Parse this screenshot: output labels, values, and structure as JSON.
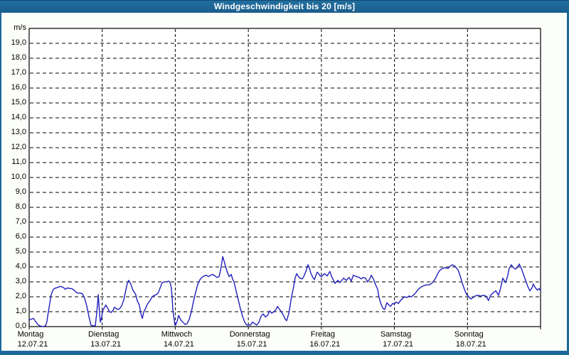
{
  "window": {
    "title": "Windgeschwindigkeit bis 20 [m/s]"
  },
  "colors": {
    "titlebar": "#1d689a",
    "frame": "#1d689a",
    "page_bg": "#fcfefa",
    "plot_bg": "#ffffff",
    "grid": "#000000",
    "text": "#000000",
    "line": "#2020bb"
  },
  "chart_data": {
    "type": "line",
    "title": "Windgeschwindigkeit bis 20 [m/s]",
    "ylabel": "m/s",
    "xlabel": "",
    "grid": true,
    "legend_position": "none",
    "y_axis": {
      "unit_label": "m/s",
      "min": 0,
      "max": 20,
      "tick_step": 1.0,
      "tick_labels": [
        "19,0",
        "18,0",
        "17,0",
        "16,0",
        "15,0",
        "14,0",
        "13,0",
        "12,0",
        "11,0",
        "10,0",
        "9,0",
        "8,0",
        "7,0",
        "6,0",
        "5,0",
        "4,0",
        "3,0",
        "2,0",
        "1,0",
        "0,0"
      ]
    },
    "x_axis": {
      "total_hours": 168,
      "days": [
        {
          "name": "Montag",
          "date": "12.07.21"
        },
        {
          "name": "Dienstag",
          "date": "13.07.21"
        },
        {
          "name": "Mittwoch",
          "date": "14.07.21"
        },
        {
          "name": "Donnerstag",
          "date": "15.07.21"
        },
        {
          "name": "Freitag",
          "date": "16.07.21"
        },
        {
          "name": "Samstag",
          "date": "17.07.21"
        },
        {
          "name": "Sonntag",
          "date": "18.07.21"
        }
      ]
    },
    "series": [
      {
        "name": "Windgeschwindigkeit",
        "unit": "m/s",
        "points": [
          [
            0,
            0.45
          ],
          [
            0.7,
            0.5
          ],
          [
            1.4,
            0.55
          ],
          [
            2.1,
            0.35
          ],
          [
            2.8,
            0.15
          ],
          [
            3.5,
            0.05
          ],
          [
            4.4,
            0
          ],
          [
            5.4,
            0.05
          ],
          [
            5.8,
            0.3
          ],
          [
            6.3,
            1.0
          ],
          [
            6.8,
            1.6
          ],
          [
            7.2,
            2.1
          ],
          [
            7.7,
            2.4
          ],
          [
            8.2,
            2.55
          ],
          [
            8.9,
            2.6
          ],
          [
            9.6,
            2.65
          ],
          [
            10.3,
            2.7
          ],
          [
            11,
            2.65
          ],
          [
            11.4,
            2.6
          ],
          [
            11.9,
            2.5
          ],
          [
            12.6,
            2.6
          ],
          [
            13.3,
            2.55
          ],
          [
            14,
            2.55
          ],
          [
            14.7,
            2.45
          ],
          [
            15.4,
            2.3
          ],
          [
            16.1,
            2.25
          ],
          [
            16.8,
            2.25
          ],
          [
            17.5,
            2.2
          ],
          [
            18.2,
            1.9
          ],
          [
            18.9,
            1.4
          ],
          [
            19.6,
            0.7
          ],
          [
            20.3,
            0.1
          ],
          [
            21,
            0.05
          ],
          [
            21.7,
            0.05
          ],
          [
            22.2,
            0.9
          ],
          [
            22.7,
            2.15
          ],
          [
            23.1,
            0.9
          ],
          [
            23.4,
            0.3
          ],
          [
            23.8,
            0.6
          ],
          [
            24.1,
            1.05
          ],
          [
            24.8,
            1.3
          ],
          [
            25.2,
            1.45
          ],
          [
            25.9,
            1.2
          ],
          [
            26.4,
            1.0
          ],
          [
            26.9,
            0.95
          ],
          [
            27.6,
            1.1
          ],
          [
            28,
            1.3
          ],
          [
            28.7,
            1.2
          ],
          [
            29.2,
            1.15
          ],
          [
            29.7,
            1.2
          ],
          [
            30.4,
            1.4
          ],
          [
            31.1,
            1.8
          ],
          [
            31.5,
            2.2
          ],
          [
            32.2,
            2.85
          ],
          [
            32.7,
            3.1
          ],
          [
            33.4,
            2.85
          ],
          [
            34.1,
            2.45
          ],
          [
            35,
            2.15
          ],
          [
            35.5,
            1.75
          ],
          [
            36.2,
            1.45
          ],
          [
            36.7,
            0.85
          ],
          [
            37.2,
            0.55
          ],
          [
            37.6,
            0.95
          ],
          [
            38.3,
            1.25
          ],
          [
            38.8,
            1.5
          ],
          [
            39.7,
            1.75
          ],
          [
            40.4,
            2.0
          ],
          [
            41.1,
            2.1
          ],
          [
            41.8,
            2.15
          ],
          [
            42.5,
            2.3
          ],
          [
            43.2,
            2.7
          ],
          [
            43.7,
            2.95
          ],
          [
            44.4,
            3.0
          ],
          [
            45.1,
            3.0
          ],
          [
            45.8,
            3.05
          ],
          [
            46.3,
            2.95
          ],
          [
            46.7,
            2.6
          ],
          [
            47,
            1.9
          ],
          [
            47.2,
            1.1
          ],
          [
            47.7,
            0.4
          ],
          [
            47.9,
            0.1
          ],
          [
            48.1,
            0.1
          ],
          [
            48.6,
            0.35
          ],
          [
            49.1,
            0.75
          ],
          [
            49.8,
            0.45
          ],
          [
            50.5,
            0.3
          ],
          [
            51.2,
            0.15
          ],
          [
            51.9,
            0.2
          ],
          [
            52.6,
            0.5
          ],
          [
            53.3,
            1.0
          ],
          [
            54,
            1.7
          ],
          [
            54.7,
            2.3
          ],
          [
            55.4,
            2.85
          ],
          [
            56.1,
            3.15
          ],
          [
            56.8,
            3.3
          ],
          [
            57.5,
            3.4
          ],
          [
            58.2,
            3.45
          ],
          [
            58.9,
            3.35
          ],
          [
            59.6,
            3.45
          ],
          [
            60.3,
            3.5
          ],
          [
            61,
            3.4
          ],
          [
            61.7,
            3.3
          ],
          [
            62.4,
            3.35
          ],
          [
            62.9,
            3.8
          ],
          [
            63.6,
            4.7
          ],
          [
            64.3,
            4.2
          ],
          [
            65,
            3.7
          ],
          [
            65.7,
            3.35
          ],
          [
            66.4,
            3.5
          ],
          [
            66.8,
            3.2
          ],
          [
            67.3,
            3.0
          ],
          [
            68,
            2.4
          ],
          [
            68.7,
            1.8
          ],
          [
            69.4,
            1.2
          ],
          [
            70.1,
            0.7
          ],
          [
            70.8,
            0.3
          ],
          [
            71.5,
            0.1
          ],
          [
            72,
            0.1
          ],
          [
            72.7,
            0.1
          ],
          [
            73.4,
            0.3
          ],
          [
            74.1,
            0.2
          ],
          [
            74.8,
            0.1
          ],
          [
            75.5,
            0.3
          ],
          [
            76.2,
            0.7
          ],
          [
            76.9,
            0.85
          ],
          [
            77.6,
            0.65
          ],
          [
            78.3,
            0.75
          ],
          [
            79,
            1.05
          ],
          [
            79.7,
            0.9
          ],
          [
            80.4,
            1.0
          ],
          [
            81.1,
            1.15
          ],
          [
            81.6,
            1.35
          ],
          [
            82.3,
            1.15
          ],
          [
            83,
            0.95
          ],
          [
            83.7,
            0.7
          ],
          [
            84.1,
            0.5
          ],
          [
            84.6,
            0.4
          ],
          [
            85.3,
            0.9
          ],
          [
            85.8,
            1.5
          ],
          [
            86.2,
            2.0
          ],
          [
            86.7,
            2.5
          ],
          [
            87.4,
            3.3
          ],
          [
            87.9,
            3.55
          ],
          [
            88.3,
            3.4
          ],
          [
            89,
            3.25
          ],
          [
            89.7,
            3.2
          ],
          [
            90.2,
            3.35
          ],
          [
            90.9,
            3.7
          ],
          [
            91.6,
            4.15
          ],
          [
            92.1,
            3.9
          ],
          [
            92.5,
            3.6
          ],
          [
            93.2,
            3.3
          ],
          [
            93.7,
            3.15
          ],
          [
            94.2,
            3.45
          ],
          [
            94.6,
            3.65
          ],
          [
            95.1,
            3.55
          ],
          [
            95.6,
            3.4
          ],
          [
            96,
            3.35
          ],
          [
            97,
            3.55
          ],
          [
            97.9,
            3.4
          ],
          [
            98.8,
            3.7
          ],
          [
            99.5,
            3.3
          ],
          [
            100.5,
            2.9
          ],
          [
            101.4,
            3.1
          ],
          [
            102.1,
            2.95
          ],
          [
            103.3,
            3.25
          ],
          [
            104.2,
            3.1
          ],
          [
            105.1,
            3.3
          ],
          [
            105.8,
            3.05
          ],
          [
            106.5,
            3.45
          ],
          [
            107.5,
            3.35
          ],
          [
            108.4,
            3.3
          ],
          [
            109.1,
            3.2
          ],
          [
            109.8,
            3.3
          ],
          [
            110.5,
            3.25
          ],
          [
            111.2,
            3.0
          ],
          [
            111.9,
            3.2
          ],
          [
            112.4,
            3.45
          ],
          [
            113.1,
            3.2
          ],
          [
            113.6,
            2.9
          ],
          [
            114.5,
            2.5
          ],
          [
            114.9,
            2.0
          ],
          [
            115.6,
            1.5
          ],
          [
            116.3,
            1.2
          ],
          [
            116.8,
            1.15
          ],
          [
            117.5,
            1.6
          ],
          [
            118.2,
            1.45
          ],
          [
            118.7,
            1.35
          ],
          [
            119.4,
            1.55
          ],
          [
            119.9,
            1.5
          ],
          [
            120.6,
            1.65
          ],
          [
            121.3,
            1.55
          ],
          [
            122,
            1.75
          ],
          [
            122.7,
            1.9
          ],
          [
            123.4,
            2.0
          ],
          [
            124.1,
            1.95
          ],
          [
            124.8,
            2.05
          ],
          [
            125.5,
            2.0
          ],
          [
            126.2,
            2.1
          ],
          [
            126.9,
            2.25
          ],
          [
            127.8,
            2.5
          ],
          [
            128.7,
            2.65
          ],
          [
            129.7,
            2.75
          ],
          [
            130.6,
            2.8
          ],
          [
            131.5,
            2.8
          ],
          [
            132.5,
            2.95
          ],
          [
            133.4,
            3.2
          ],
          [
            134.1,
            3.5
          ],
          [
            134.8,
            3.75
          ],
          [
            135.7,
            3.9
          ],
          [
            136.7,
            3.95
          ],
          [
            137.6,
            3.9
          ],
          [
            138.3,
            4.05
          ],
          [
            139,
            4.15
          ],
          [
            139.9,
            4.05
          ],
          [
            140.9,
            3.8
          ],
          [
            141.6,
            3.4
          ],
          [
            142.3,
            2.9
          ],
          [
            143,
            2.5
          ],
          [
            143.7,
            2.15
          ],
          [
            144.2,
            2.05
          ],
          [
            145.1,
            1.85
          ],
          [
            145.8,
            1.95
          ],
          [
            146.5,
            2.05
          ],
          [
            147.4,
            2.1
          ],
          [
            148.4,
            2.05
          ],
          [
            149.3,
            2.1
          ],
          [
            150,
            2.05
          ],
          [
            150.9,
            1.75
          ],
          [
            151.6,
            2.1
          ],
          [
            152.6,
            2.3
          ],
          [
            153.3,
            2.4
          ],
          [
            154.2,
            2.1
          ],
          [
            154.9,
            2.6
          ],
          [
            155.6,
            3.25
          ],
          [
            156.5,
            2.95
          ],
          [
            157.2,
            3.4
          ],
          [
            157.7,
            3.9
          ],
          [
            158.4,
            4.15
          ],
          [
            159.1,
            3.95
          ],
          [
            159.8,
            3.85
          ],
          [
            160.5,
            4.0
          ],
          [
            161,
            4.2
          ],
          [
            161.7,
            3.9
          ],
          [
            162.4,
            3.5
          ],
          [
            163.1,
            3.1
          ],
          [
            163.8,
            2.7
          ],
          [
            164.5,
            2.4
          ],
          [
            165.2,
            2.6
          ],
          [
            165.6,
            2.85
          ],
          [
            166.3,
            2.6
          ],
          [
            167,
            2.45
          ],
          [
            167.5,
            2.55
          ],
          [
            168,
            2.4
          ]
        ]
      }
    ]
  }
}
